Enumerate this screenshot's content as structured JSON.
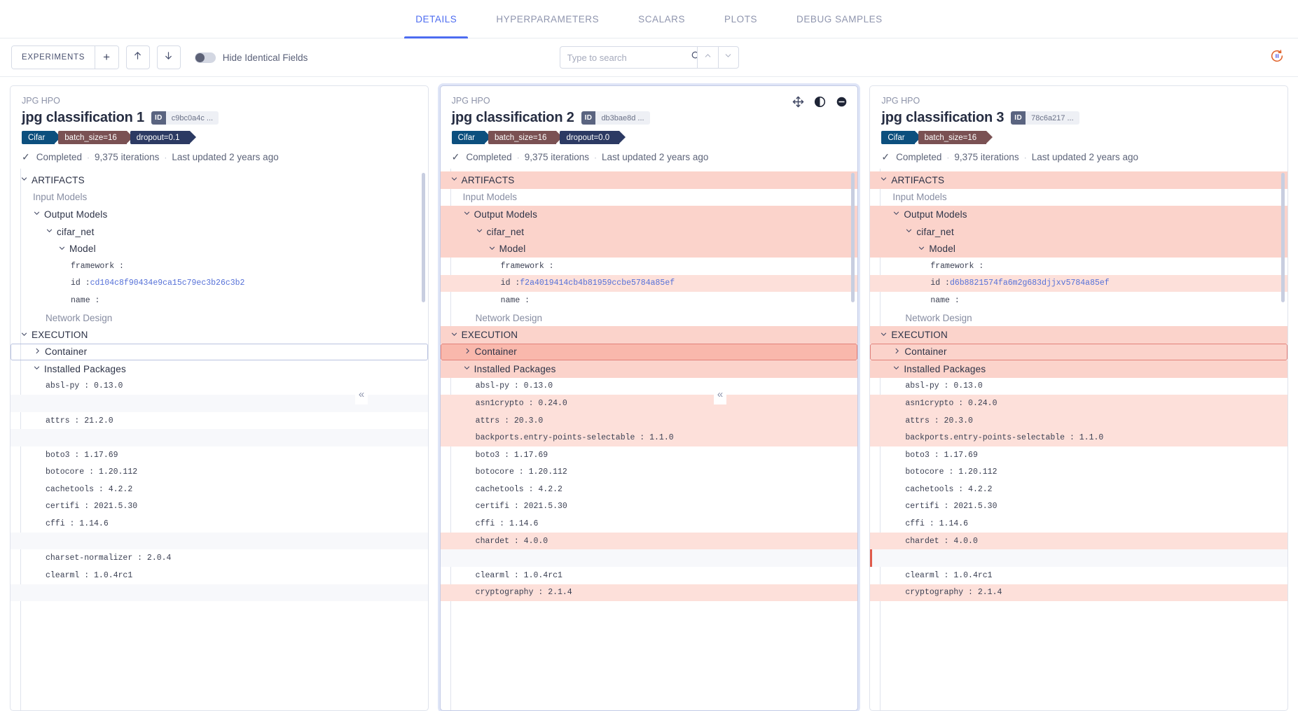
{
  "tabs": [
    {
      "label": "DETAILS",
      "active": true
    },
    {
      "label": "HYPERPARAMETERS",
      "active": false
    },
    {
      "label": "SCALARS",
      "active": false
    },
    {
      "label": "PLOTS",
      "active": false
    },
    {
      "label": "DEBUG SAMPLES",
      "active": false
    }
  ],
  "toolbar": {
    "experiments_label": "EXPERIMENTS",
    "add_label": "+",
    "up_icon": "arrow-up-icon",
    "down_icon": "arrow-down-icon",
    "hide_identical_label": "Hide Identical Fields",
    "hide_identical_on": false,
    "refresh_icon": "refresh-pause-icon"
  },
  "search": {
    "placeholder": "Type to search",
    "value": "",
    "search_icon": "search-icon",
    "prev_icon": "chevron-up-icon",
    "next_icon": "chevron-down-icon"
  },
  "collapse_left_label": "«",
  "accent": "#4d6cf0",
  "highlight_color": "#fbd3cb",
  "columns": [
    {
      "project": "JPG HPO",
      "name": "jpg classification 1",
      "id_label": "ID",
      "id_value": "c9bc0a4c ...",
      "tags": [
        "Cifar",
        "batch_size=16",
        "dropout=0.1"
      ],
      "status": "Completed",
      "iterations": "9,375 iterations",
      "updated": "Last updated 2 years ago",
      "selected": false,
      "has_card_icons": false,
      "rows": [
        {
          "text": "ARTIFACTS",
          "indent": 0,
          "caret": "down",
          "kind": "section",
          "style": "plain"
        },
        {
          "text": "Input Models",
          "indent": 1,
          "caret": "",
          "kind": "muted",
          "style": "plain"
        },
        {
          "text": "Output Models",
          "indent": 1,
          "caret": "down",
          "kind": "section",
          "style": "plain"
        },
        {
          "text": "cifar_net",
          "indent": 2,
          "caret": "down",
          "kind": "section",
          "style": "plain"
        },
        {
          "text": "Model",
          "indent": 3,
          "caret": "down",
          "kind": "section",
          "style": "plain"
        },
        {
          "text": "framework :",
          "indent": 4,
          "caret": "",
          "kind": "kv",
          "style": "plain"
        },
        {
          "text": "id : ",
          "link": "cd104c8f90434e9ca15c79ec3b26c3b2",
          "indent": 4,
          "caret": "",
          "kind": "kv",
          "style": "plain"
        },
        {
          "text": "name :",
          "indent": 4,
          "caret": "",
          "kind": "kv",
          "style": "plain"
        },
        {
          "text": "Network Design",
          "indent": 2,
          "caret": "",
          "kind": "muted",
          "style": "plain"
        },
        {
          "text": "EXECUTION",
          "indent": 0,
          "caret": "down",
          "kind": "section",
          "style": "plain"
        },
        {
          "text": "Container",
          "indent": 1,
          "caret": "right",
          "kind": "section",
          "style": "outline"
        },
        {
          "text": "Installed Packages",
          "indent": 1,
          "caret": "down",
          "kind": "section",
          "style": "plain"
        },
        {
          "text": "absl-py : 0.13.0",
          "indent": 2,
          "caret": "",
          "kind": "kv",
          "style": "plain"
        },
        {
          "text": "",
          "indent": 2,
          "caret": "",
          "kind": "kv",
          "style": "alt"
        },
        {
          "text": "attrs : 21.2.0",
          "indent": 2,
          "caret": "",
          "kind": "kv",
          "style": "plain"
        },
        {
          "text": "",
          "indent": 2,
          "caret": "",
          "kind": "kv",
          "style": "alt"
        },
        {
          "text": "boto3 : 1.17.69",
          "indent": 2,
          "caret": "",
          "kind": "kv",
          "style": "plain"
        },
        {
          "text": "botocore : 1.20.112",
          "indent": 2,
          "caret": "",
          "kind": "kv",
          "style": "plain"
        },
        {
          "text": "cachetools : 4.2.2",
          "indent": 2,
          "caret": "",
          "kind": "kv",
          "style": "plain"
        },
        {
          "text": "certifi : 2021.5.30",
          "indent": 2,
          "caret": "",
          "kind": "kv",
          "style": "plain"
        },
        {
          "text": "cffi : 1.14.6",
          "indent": 2,
          "caret": "",
          "kind": "kv",
          "style": "plain"
        },
        {
          "text": "",
          "indent": 2,
          "caret": "",
          "kind": "kv",
          "style": "alt"
        },
        {
          "text": "charset-normalizer : 2.0.4",
          "indent": 2,
          "caret": "",
          "kind": "kv",
          "style": "plain"
        },
        {
          "text": "clearml : 1.0.4rc1",
          "indent": 2,
          "caret": "",
          "kind": "kv",
          "style": "plain"
        },
        {
          "text": "",
          "indent": 2,
          "caret": "",
          "kind": "kv",
          "style": "alt"
        }
      ]
    },
    {
      "project": "JPG HPO",
      "name": "jpg classification 2",
      "id_label": "ID",
      "id_value": "db3bae8d ...",
      "tags": [
        "Cifar",
        "batch_size=16",
        "dropout=0.0"
      ],
      "status": "Completed",
      "iterations": "9,375 iterations",
      "updated": "Last updated 2 years ago",
      "selected": true,
      "has_card_icons": true,
      "card_icons": [
        "move-icon",
        "contrast-icon",
        "minus-circle-icon"
      ],
      "rows": [
        {
          "text": "ARTIFACTS",
          "indent": 0,
          "caret": "down",
          "kind": "section",
          "style": "hl"
        },
        {
          "text": "Input Models",
          "indent": 1,
          "caret": "",
          "kind": "muted",
          "style": "plain"
        },
        {
          "text": "Output Models",
          "indent": 1,
          "caret": "down",
          "kind": "section",
          "style": "hl"
        },
        {
          "text": "cifar_net",
          "indent": 2,
          "caret": "down",
          "kind": "section",
          "style": "hl"
        },
        {
          "text": "Model",
          "indent": 3,
          "caret": "down",
          "kind": "section",
          "style": "hl"
        },
        {
          "text": "framework :",
          "indent": 4,
          "caret": "",
          "kind": "kv",
          "style": "plain"
        },
        {
          "text": "id : ",
          "link": "f2a4019414cb4b81959ccbe5784a85ef",
          "indent": 4,
          "caret": "",
          "kind": "kv",
          "style": "hl-soft"
        },
        {
          "text": "name :",
          "indent": 4,
          "caret": "",
          "kind": "kv",
          "style": "plain"
        },
        {
          "text": "Network Design",
          "indent": 2,
          "caret": "",
          "kind": "muted",
          "style": "plain"
        },
        {
          "text": "EXECUTION",
          "indent": 0,
          "caret": "down",
          "kind": "section",
          "style": "hl"
        },
        {
          "text": "Container",
          "indent": 1,
          "caret": "right",
          "kind": "section",
          "style": "hl-strong outline-red"
        },
        {
          "text": "Installed Packages",
          "indent": 1,
          "caret": "down",
          "kind": "section",
          "style": "hl"
        },
        {
          "text": "absl-py : 0.13.0",
          "indent": 2,
          "caret": "",
          "kind": "kv",
          "style": "plain"
        },
        {
          "text": "asn1crypto : 0.24.0",
          "indent": 2,
          "caret": "",
          "kind": "kv",
          "style": "hl-soft"
        },
        {
          "text": "attrs : 20.3.0",
          "indent": 2,
          "caret": "",
          "kind": "kv",
          "style": "hl-soft"
        },
        {
          "text": "backports.entry-points-selectable : 1.1.0",
          "indent": 2,
          "caret": "",
          "kind": "kv",
          "style": "hl-soft"
        },
        {
          "text": "boto3 : 1.17.69",
          "indent": 2,
          "caret": "",
          "kind": "kv",
          "style": "plain"
        },
        {
          "text": "botocore : 1.20.112",
          "indent": 2,
          "caret": "",
          "kind": "kv",
          "style": "plain"
        },
        {
          "text": "cachetools : 4.2.2",
          "indent": 2,
          "caret": "",
          "kind": "kv",
          "style": "plain"
        },
        {
          "text": "certifi : 2021.5.30",
          "indent": 2,
          "caret": "",
          "kind": "kv",
          "style": "plain"
        },
        {
          "text": "cffi : 1.14.6",
          "indent": 2,
          "caret": "",
          "kind": "kv",
          "style": "plain"
        },
        {
          "text": "chardet : 4.0.0",
          "indent": 2,
          "caret": "",
          "kind": "kv",
          "style": "hl-soft"
        },
        {
          "text": "",
          "indent": 2,
          "caret": "",
          "kind": "kv",
          "style": "alt"
        },
        {
          "text": "clearml : 1.0.4rc1",
          "indent": 2,
          "caret": "",
          "kind": "kv",
          "style": "plain"
        },
        {
          "text": "cryptography : 2.1.4",
          "indent": 2,
          "caret": "",
          "kind": "kv",
          "style": "hl-soft"
        }
      ]
    },
    {
      "project": "JPG HPO",
      "name": "jpg classification 3",
      "id_label": "ID",
      "id_value": "78c6a217 ...",
      "tags": [
        "Cifar",
        "batch_size=16"
      ],
      "status": "Completed",
      "iterations": "9,375 iterations",
      "updated": "Last updated 2 years ago",
      "selected": false,
      "has_card_icons": false,
      "rows": [
        {
          "text": "ARTIFACTS",
          "indent": 0,
          "caret": "down",
          "kind": "section",
          "style": "hl"
        },
        {
          "text": "Input Models",
          "indent": 1,
          "caret": "",
          "kind": "muted",
          "style": "plain"
        },
        {
          "text": "Output Models",
          "indent": 1,
          "caret": "down",
          "kind": "section",
          "style": "hl"
        },
        {
          "text": "cifar_net",
          "indent": 2,
          "caret": "down",
          "kind": "section",
          "style": "hl"
        },
        {
          "text": "Model",
          "indent": 3,
          "caret": "down",
          "kind": "section",
          "style": "hl"
        },
        {
          "text": "framework :",
          "indent": 4,
          "caret": "",
          "kind": "kv",
          "style": "plain"
        },
        {
          "text": "id : ",
          "link": "d6b8821574fa6m2g683djjxv5784a85ef",
          "indent": 4,
          "caret": "",
          "kind": "kv",
          "style": "hl-soft"
        },
        {
          "text": "name :",
          "indent": 4,
          "caret": "",
          "kind": "kv",
          "style": "plain"
        },
        {
          "text": "Network Design",
          "indent": 2,
          "caret": "",
          "kind": "muted",
          "style": "plain"
        },
        {
          "text": "EXECUTION",
          "indent": 0,
          "caret": "down",
          "kind": "section",
          "style": "hl"
        },
        {
          "text": "Container",
          "indent": 1,
          "caret": "right",
          "kind": "section",
          "style": "hl outline-red"
        },
        {
          "text": "Installed Packages",
          "indent": 1,
          "caret": "down",
          "kind": "section",
          "style": "hl"
        },
        {
          "text": "absl-py : 0.13.0",
          "indent": 2,
          "caret": "",
          "kind": "kv",
          "style": "plain"
        },
        {
          "text": "asn1crypto : 0.24.0",
          "indent": 2,
          "caret": "",
          "kind": "kv",
          "style": "hl-soft"
        },
        {
          "text": "attrs : 20.3.0",
          "indent": 2,
          "caret": "",
          "kind": "kv",
          "style": "hl-soft"
        },
        {
          "text": "backports.entry-points-selectable : 1.1.0",
          "indent": 2,
          "caret": "",
          "kind": "kv",
          "style": "hl-soft"
        },
        {
          "text": "boto3 : 1.17.69",
          "indent": 2,
          "caret": "",
          "kind": "kv",
          "style": "plain"
        },
        {
          "text": "botocore : 1.20.112",
          "indent": 2,
          "caret": "",
          "kind": "kv",
          "style": "plain"
        },
        {
          "text": "cachetools : 4.2.2",
          "indent": 2,
          "caret": "",
          "kind": "kv",
          "style": "plain"
        },
        {
          "text": "certifi : 2021.5.30",
          "indent": 2,
          "caret": "",
          "kind": "kv",
          "style": "plain"
        },
        {
          "text": "cffi : 1.14.6",
          "indent": 2,
          "caret": "",
          "kind": "kv",
          "style": "plain"
        },
        {
          "text": "chardet : 4.0.0",
          "indent": 2,
          "caret": "",
          "kind": "kv",
          "style": "hl-soft"
        },
        {
          "text": "",
          "indent": 2,
          "caret": "",
          "kind": "kv",
          "style": "alt leftbar"
        },
        {
          "text": "clearml : 1.0.4rc1",
          "indent": 2,
          "caret": "",
          "kind": "kv",
          "style": "plain"
        },
        {
          "text": "cryptography : 2.1.4",
          "indent": 2,
          "caret": "",
          "kind": "kv",
          "style": "hl-soft"
        }
      ]
    }
  ]
}
